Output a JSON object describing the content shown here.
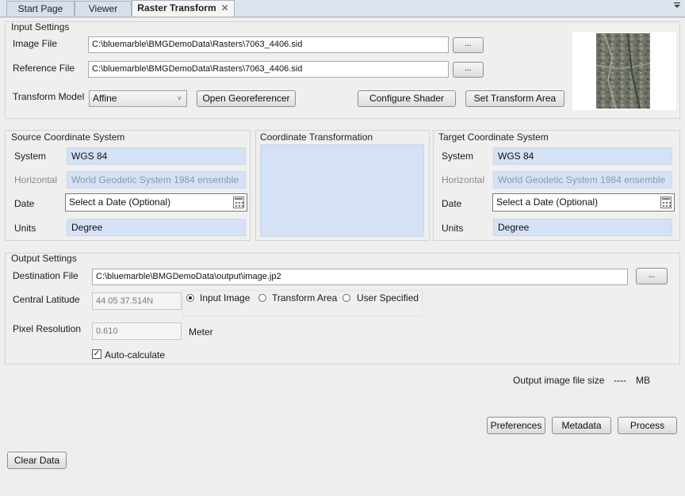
{
  "tabs": [
    {
      "label": "Start Page"
    },
    {
      "label": "Viewer"
    },
    {
      "label": "Raster Transform",
      "close": "✕"
    }
  ],
  "input_settings": {
    "title": "Input Settings",
    "image_file_label": "Image File",
    "image_file_value": "C:\\bluemarble\\BMGDemoData\\Rasters\\7063_4406.sid",
    "reference_file_label": "Reference File",
    "reference_file_value": "C:\\bluemarble\\BMGDemoData\\Rasters\\7063_4406.sid",
    "browse_label": "...",
    "transform_model_label": "Transform Model",
    "transform_model_value": "Affine",
    "open_georeferencer": "Open Georeferencer",
    "configure_shader": "Configure Shader",
    "set_transform_area": "Set Transform Area"
  },
  "source_cs": {
    "title": "Source Coordinate System",
    "system_label": "System",
    "system_value": "WGS 84",
    "horizontal_label": "Horizontal",
    "horizontal_value": "World Geodetic System 1984 ensemble",
    "date_label": "Date",
    "date_placeholder": "Select a Date (Optional)",
    "units_label": "Units",
    "units_value": "Degree"
  },
  "coord_transform": {
    "title": "Coordinate Transformation"
  },
  "target_cs": {
    "title": "Target Coordinate System",
    "system_label": "System",
    "system_value": "WGS 84",
    "horizontal_label": "Horizontal",
    "horizontal_value": "World Geodetic System 1984 ensemble",
    "date_label": "Date",
    "date_placeholder": "Select a Date (Optional)",
    "units_label": "Units",
    "units_value": "Degree"
  },
  "output_settings": {
    "title": "Output Settings",
    "destination_label": "Destination File",
    "destination_value": "C:\\bluemarble\\BMGDemoData\\output\\image.jp2",
    "browse_label": "...",
    "central_latitude_label": "Central Latitude",
    "central_latitude_value": "44 05 37.514N",
    "radio_options": [
      {
        "label": "Input Image",
        "selected": true
      },
      {
        "label": "Transform Area",
        "selected": false
      },
      {
        "label": "User Specified",
        "selected": false
      }
    ],
    "pixel_resolution_label": "Pixel Resolution",
    "pixel_resolution_value": "0.610",
    "pixel_resolution_unit": "Meter",
    "auto_calculate_label": "Auto-calculate",
    "auto_calculate_checked": true,
    "check_mark": "✓",
    "file_size_label": "Output image file size",
    "file_size_value": "----",
    "file_size_unit": "MB"
  },
  "actions": {
    "preferences": "Preferences",
    "metadata": "Metadata",
    "process": "Process",
    "clear_data": "Clear Data"
  },
  "colors": {
    "accent_field": "#d5e2f5",
    "panel_bg": "#efefef"
  },
  "icons": {
    "menu": "chevron-down-icon",
    "calendar": "calendar-icon",
    "thumbnail": "raster-thumbnail"
  }
}
